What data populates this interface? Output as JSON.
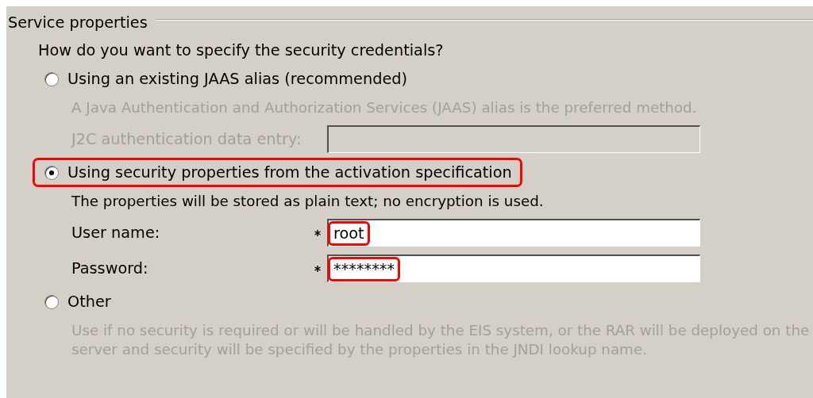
{
  "group": {
    "title": "Service properties"
  },
  "question": "How do you want to specify the security credentials?",
  "options": [
    {
      "label": "Using an existing JAAS alias (recommended)",
      "selected": false,
      "highlighted": false,
      "description": "A Java Authentication and Authorization Services (JAAS) alias is the preferred method.",
      "enabled": false,
      "fields": [
        {
          "label": "J2C authentication data entry:",
          "required": false
        }
      ]
    },
    {
      "label": "Using security properties from the activation specification",
      "selected": true,
      "highlighted": true,
      "description": "The properties will be stored as plain text; no encryption is used.",
      "enabled": true,
      "fields": [
        {
          "label": "User name:",
          "required": true,
          "value": "root",
          "highlighted": true
        },
        {
          "label": "Password:",
          "required": true,
          "value": "********",
          "highlighted": true
        }
      ]
    },
    {
      "label": "Other",
      "selected": false,
      "highlighted": false,
      "description": "Use if no security is required or will be handled by the EIS system, or the RAR will be deployed on the server and security will be specified by the properties in the JNDI lookup name.",
      "enabled": false
    }
  ]
}
